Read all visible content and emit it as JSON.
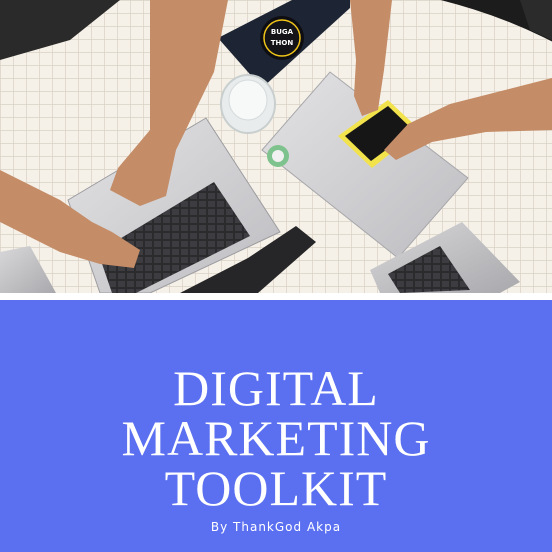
{
  "cover": {
    "title_lines": [
      "DIGITAL",
      "MARKETING",
      "TOOLKIT"
    ],
    "byline": "By ThankGod Akpa",
    "photo": {
      "description_icon": "photo-image",
      "sticker_text": [
        "BUGA",
        "THON"
      ]
    },
    "colors": {
      "panel": "#5b70f1",
      "title": "#ffffff",
      "table": "#f4efe6",
      "tile_grid": "#d8d0c3"
    }
  }
}
